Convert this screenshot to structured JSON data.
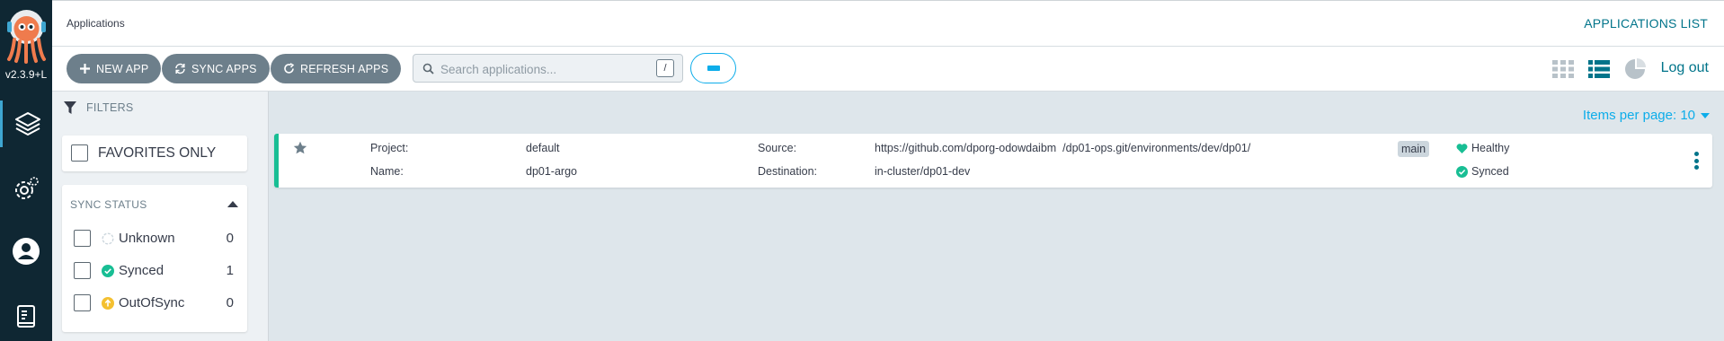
{
  "nav": {
    "version": "v2.3.9+L",
    "items": [
      "applications",
      "settings",
      "user-info",
      "documentation"
    ]
  },
  "header": {
    "title": "Applications",
    "list_title": "APPLICATIONS LIST"
  },
  "toolbar": {
    "new_app": "NEW APP",
    "sync_apps": "SYNC APPS",
    "refresh_apps": "REFRESH APPS",
    "search_placeholder": "Search applications...",
    "search_shortcut": "/",
    "logout": "Log out",
    "views": [
      "tiles-view-icon",
      "list-view-icon",
      "summary-view-icon"
    ]
  },
  "filters": {
    "heading": "FILTERS",
    "favorites_label": "FAVORITES ONLY",
    "sync_status": {
      "title": "SYNC STATUS",
      "items": [
        {
          "label": "Unknown",
          "count": "0"
        },
        {
          "label": "Synced",
          "count": "1"
        },
        {
          "label": "OutOfSync",
          "count": "0"
        }
      ]
    }
  },
  "main": {
    "items_per_page": "Items per page: 10",
    "app": {
      "project_label": "Project:",
      "project": "default",
      "name_label": "Name:",
      "name": "dp01-argo",
      "source_label": "Source:",
      "source": "https://github.com/dporg-odowdaibm  /dp01-ops.git/environments/dev/dp01/",
      "destination_label": "Destination:",
      "destination": "in-cluster/dp01-dev",
      "branch": "main",
      "health": "Healthy",
      "sync": "Synced"
    }
  },
  "colors": {
    "nav_bg": "#0f2733",
    "accent": "#00748a",
    "healthy": "#18be94",
    "button": "#6d7f8b"
  }
}
